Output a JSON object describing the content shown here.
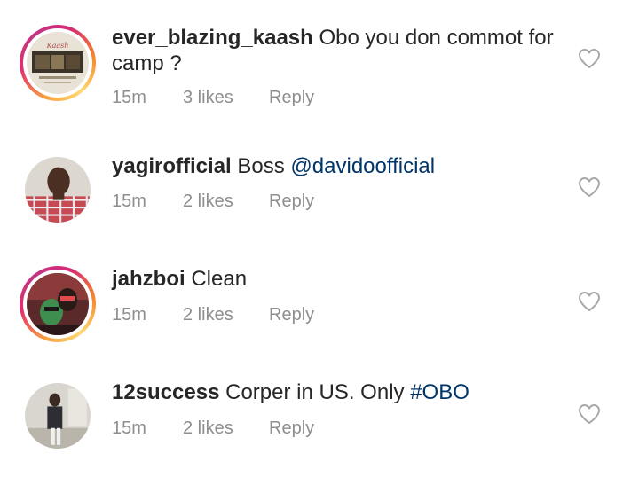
{
  "comments": [
    {
      "username": "ever_blazing_kaash",
      "text": " Obo you don commot for camp ?",
      "time": "15m",
      "likes": "3 likes",
      "reply": "Reply",
      "avatar_icon": "avatar-photo",
      "has_story": true
    },
    {
      "username": "yagirofficial",
      "text_before": " Boss ",
      "mention": "@davidoofficial",
      "time": "15m",
      "likes": "2 likes",
      "reply": "Reply",
      "avatar_icon": "avatar-photo",
      "has_story": false
    },
    {
      "username": "jahzboi",
      "text": " Clean",
      "time": "15m",
      "likes": "2 likes",
      "reply": "Reply",
      "avatar_icon": "avatar-photo",
      "has_story": true
    },
    {
      "username": "12success",
      "text_before": " Corper in US. Only ",
      "hashtag": "#OBO",
      "time": "15m",
      "likes": "2 likes",
      "reply": "Reply",
      "avatar_icon": "avatar-photo",
      "has_story": false
    }
  ],
  "like_icon": "heart-outline-icon",
  "colors": {
    "text": "#262626",
    "meta": "#8e8e8e",
    "link": "#003569",
    "icon": "#a8a8a8"
  }
}
